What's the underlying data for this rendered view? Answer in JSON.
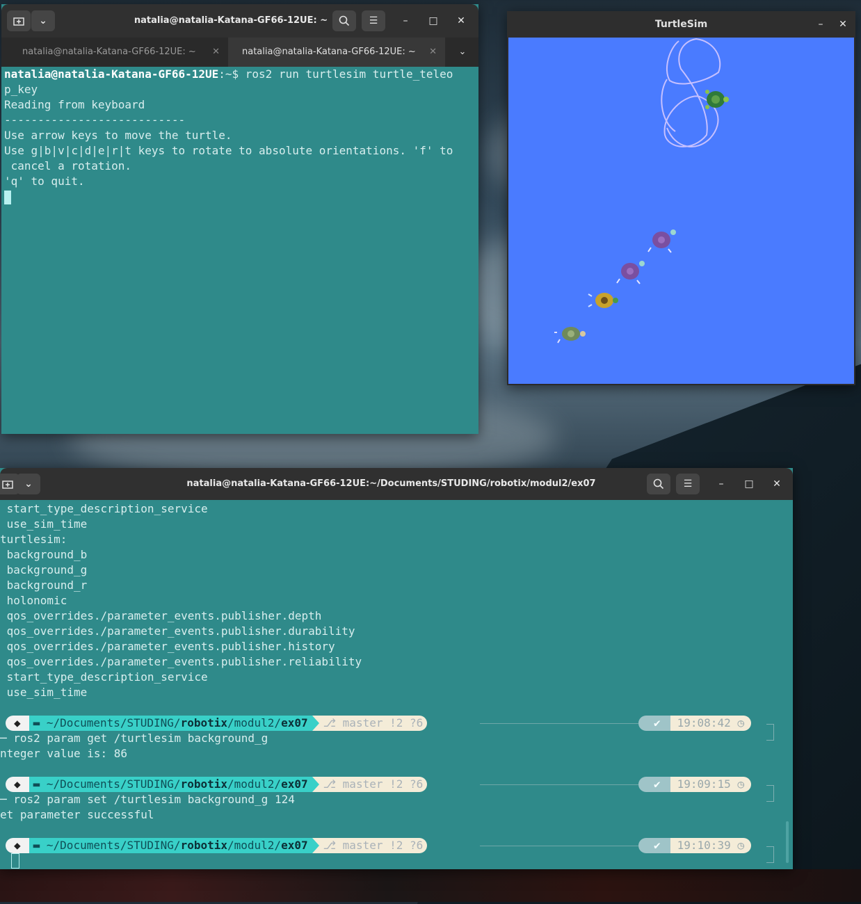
{
  "terminal1": {
    "title": "natalia@natalia-Katana-GF66-12UE: ~",
    "tabs": [
      {
        "label": "natalia@natalia-Katana-GF66-12UE: ~"
      },
      {
        "label": "natalia@natalia-Katana-GF66-12UE: ~"
      }
    ],
    "prompt_user": "natalia@natalia-Katana-GF66-12UE",
    "prompt_rest": ":~$ ros2 run turtlesim turtle_teleo",
    "lines": [
      "p_key",
      "Reading from keyboard",
      "---------------------------",
      "Use arrow keys to move the turtle.",
      "Use g|b|v|c|d|e|r|t keys to rotate to absolute orientations. 'f' to",
      " cancel a rotation.",
      "'q' to quit."
    ]
  },
  "turtlesim": {
    "title": "TurtleSim",
    "background_color": "#4a7bff"
  },
  "terminal2": {
    "title": "natalia@natalia-Katana-GF66-12UE:~/Documents/STUDING/robotix/modul2/ex07",
    "lines": [
      " start_type_description_service",
      " use_sim_time",
      "turtlesim:",
      " background_b",
      " background_g",
      " background_r",
      " holonomic",
      " qos_overrides./parameter_events.publisher.depth",
      " qos_overrides./parameter_events.publisher.durability",
      " qos_overrides./parameter_events.publisher.history",
      " qos_overrides./parameter_events.publisher.reliability",
      " start_type_description_service",
      " use_sim_time"
    ],
    "prompt": {
      "path_home": "~/Documents/STUDING/",
      "path_bold": "robotix",
      "path_mid": "/modul2/",
      "path_last": "ex07",
      "git": "master !2 ?6",
      "ok": "✔"
    },
    "times": [
      "19:08:42",
      "19:09:15",
      "19:10:39"
    ],
    "cmd1": "─ ros2 param get /turtlesim background_g",
    "out1": "nteger value is: 86",
    "cmd2": "─ ros2 param set /turtlesim background_g 124",
    "out2": "et parameter successful"
  }
}
